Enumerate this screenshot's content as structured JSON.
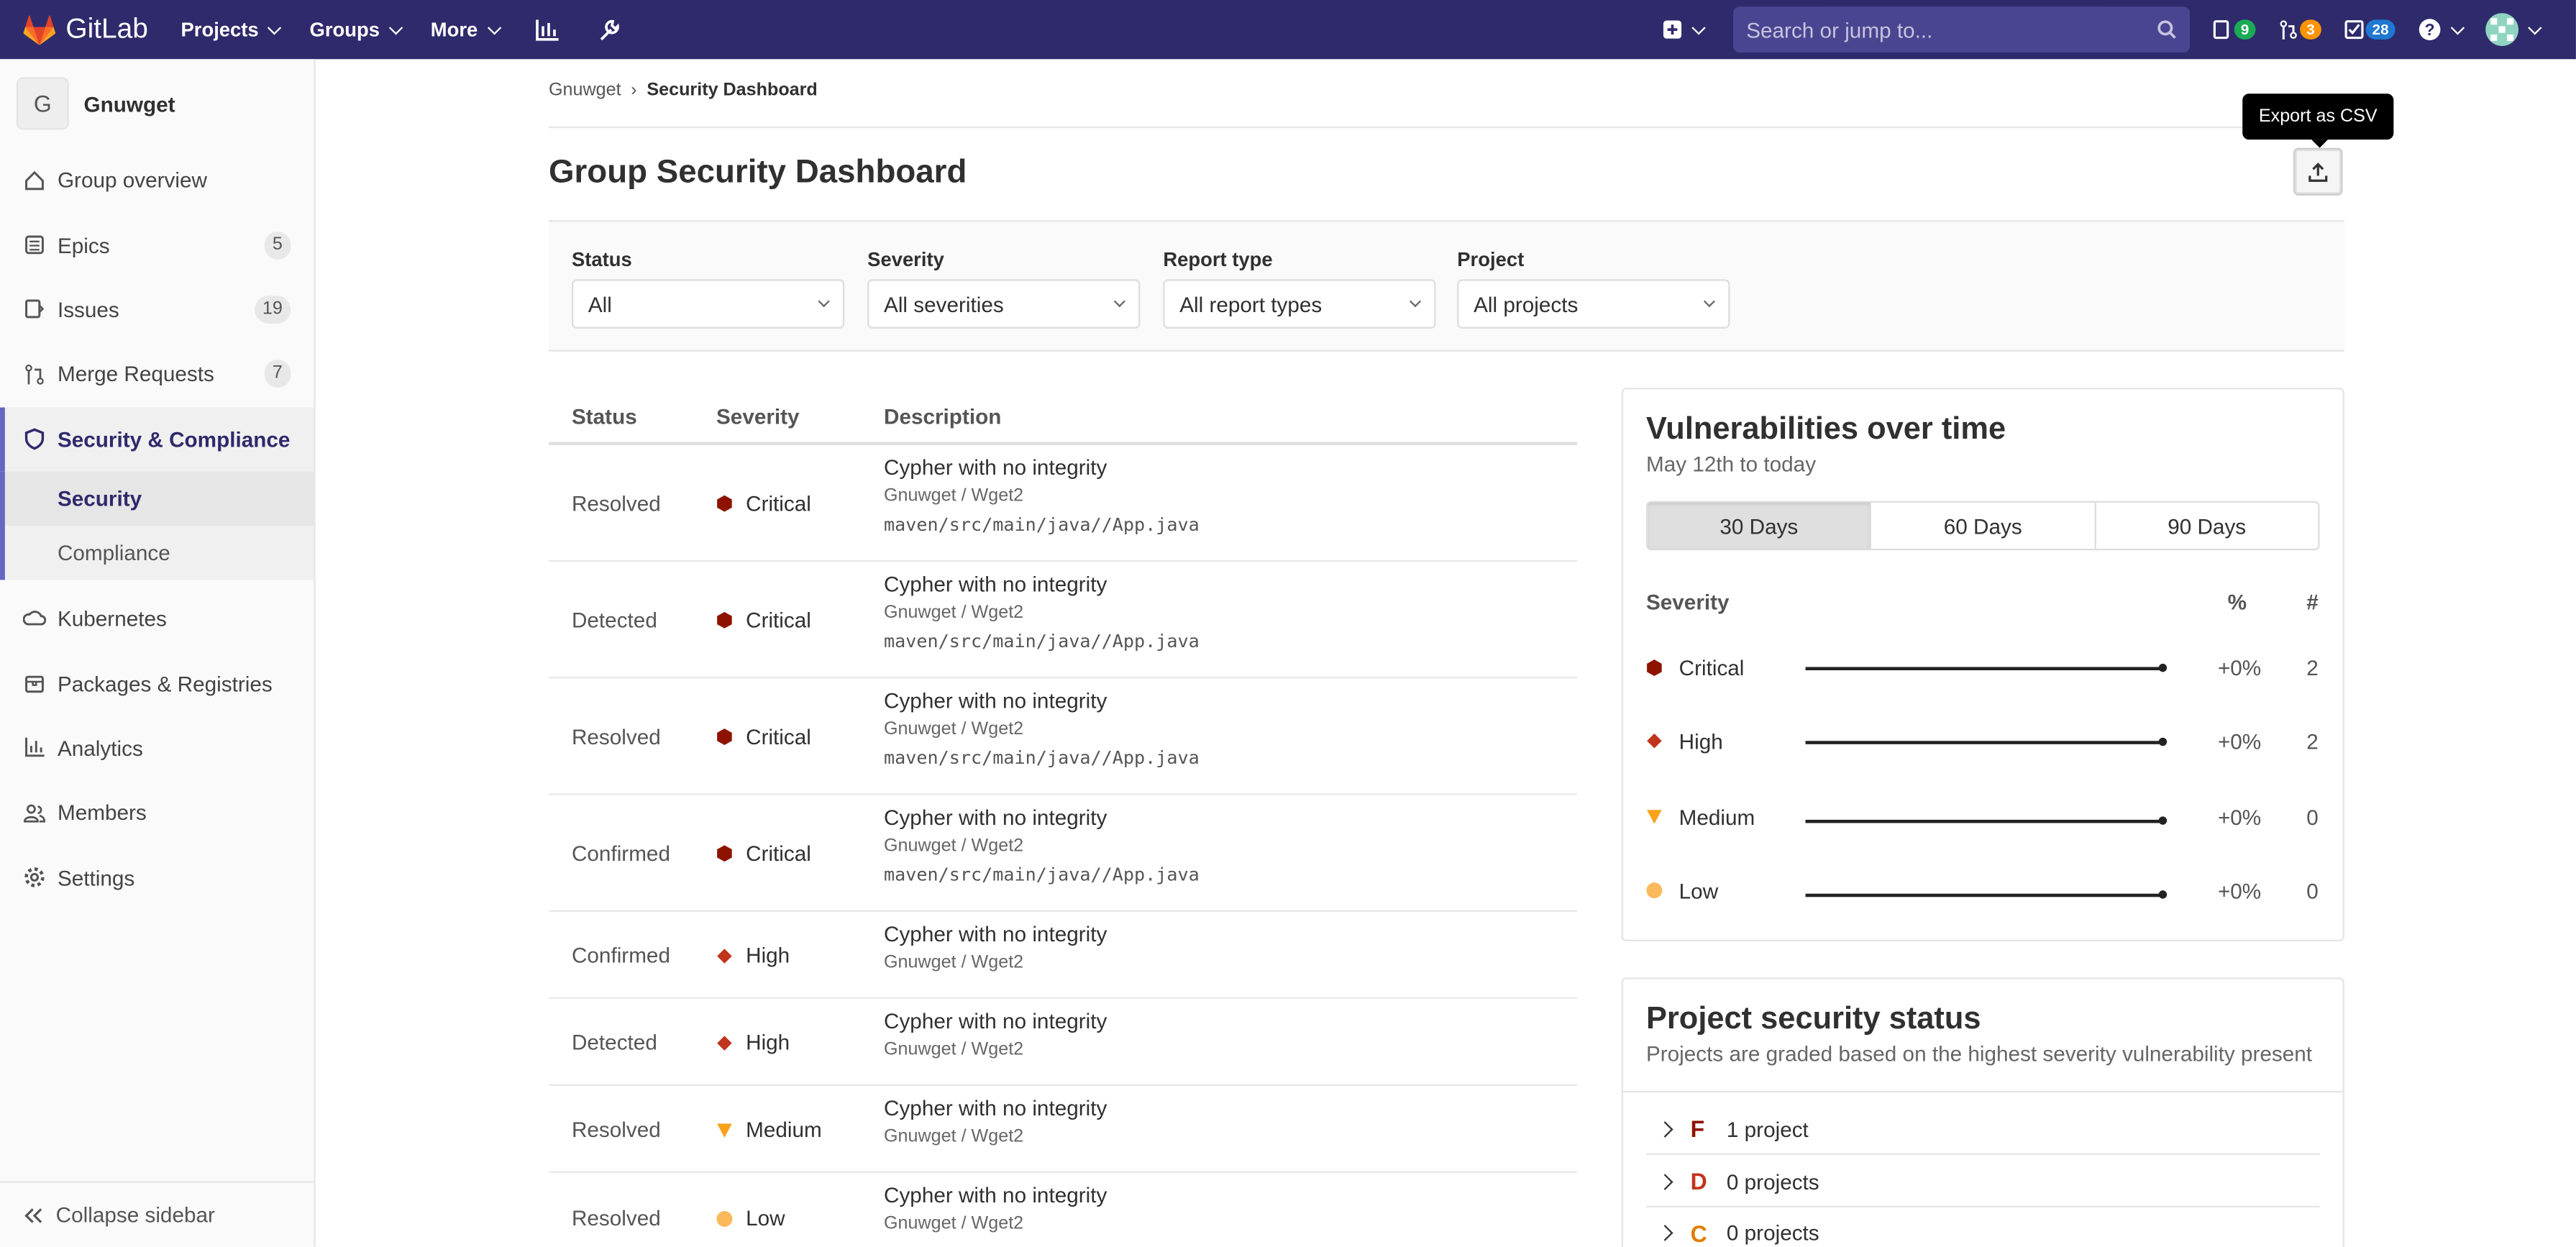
{
  "topbar": {
    "brand": "GitLab",
    "menu": [
      {
        "label": "Projects"
      },
      {
        "label": "Groups"
      },
      {
        "label": "More"
      }
    ],
    "search_placeholder": "Search or jump to...",
    "issues_count": "9",
    "mr_count": "3",
    "todo_count": "28",
    "colors": {
      "bg": "#2f2a6b",
      "issues": "#1aaa55",
      "mr": "#fc9403",
      "todo": "#1f78d1"
    }
  },
  "sidebar": {
    "group_initial": "G",
    "group_name": "Gnuwget",
    "items": [
      {
        "label": "Group overview",
        "icon": "home-icon"
      },
      {
        "label": "Epics",
        "icon": "epic-icon",
        "badge": "5"
      },
      {
        "label": "Issues",
        "icon": "issues-icon",
        "badge": "19"
      },
      {
        "label": "Merge Requests",
        "icon": "merge-request-icon",
        "badge": "7"
      },
      {
        "label": "Security & Compliance",
        "icon": "shield-icon"
      }
    ],
    "sub_items": [
      {
        "label": "Security"
      },
      {
        "label": "Compliance"
      }
    ],
    "items_after": [
      {
        "label": "Kubernetes",
        "icon": "kubernetes-icon"
      },
      {
        "label": "Packages & Registries",
        "icon": "package-icon"
      },
      {
        "label": "Analytics",
        "icon": "chart-icon"
      },
      {
        "label": "Members",
        "icon": "users-icon"
      },
      {
        "label": "Settings",
        "icon": "gear-icon"
      }
    ],
    "collapse_label": "Collapse sidebar"
  },
  "breadcrumb": {
    "parent": "Gnuwget",
    "current": "Security Dashboard"
  },
  "page_title": "Group Security Dashboard",
  "export_tooltip": "Export as CSV",
  "filters": [
    {
      "label": "Status",
      "value": "All"
    },
    {
      "label": "Severity",
      "value": "All severities"
    },
    {
      "label": "Report type",
      "value": "All report types"
    },
    {
      "label": "Project",
      "value": "All projects"
    }
  ],
  "table": {
    "headers": {
      "status": "Status",
      "severity": "Severity",
      "description": "Description"
    },
    "rows": [
      {
        "status": "Resolved",
        "severity": "Critical",
        "title": "Cypher with no integrity",
        "project": "Gnuwget / Wget2",
        "file": "maven/src/main/java//App.java"
      },
      {
        "status": "Detected",
        "severity": "Critical",
        "title": "Cypher with no integrity",
        "project": "Gnuwget / Wget2",
        "file": "maven/src/main/java//App.java"
      },
      {
        "status": "Resolved",
        "severity": "Critical",
        "title": "Cypher with no integrity",
        "project": "Gnuwget / Wget2",
        "file": "maven/src/main/java//App.java"
      },
      {
        "status": "Confirmed",
        "severity": "Critical",
        "title": "Cypher with no integrity",
        "project": "Gnuwget / Wget2",
        "file": "maven/src/main/java//App.java"
      },
      {
        "status": "Confirmed",
        "severity": "High",
        "title": "Cypher with no integrity",
        "project": "Gnuwget / Wget2"
      },
      {
        "status": "Detected",
        "severity": "High",
        "title": "Cypher with no integrity",
        "project": "Gnuwget / Wget2"
      },
      {
        "status": "Resolved",
        "severity": "Medium",
        "title": "Cypher with no integrity",
        "project": "Gnuwget / Wget2"
      },
      {
        "status": "Resolved",
        "severity": "Low",
        "title": "Cypher with no integrity",
        "project": "Gnuwget / Wget2"
      }
    ]
  },
  "vulns_over_time": {
    "title": "Vulnerabilities over time",
    "subtitle": "May 12th to today",
    "ranges": [
      {
        "label": "30 Days",
        "selected": true
      },
      {
        "label": "60 Days"
      },
      {
        "label": "90 Days"
      }
    ],
    "headers": {
      "severity": "Severity",
      "percent": "%",
      "count": "#"
    },
    "rows": [
      {
        "name": "Critical",
        "percent": "+0%",
        "count": "2"
      },
      {
        "name": "High",
        "percent": "+0%",
        "count": "2"
      },
      {
        "name": "Medium",
        "percent": "+0%",
        "count": "0"
      },
      {
        "name": "Low",
        "percent": "+0%",
        "count": "0"
      }
    ]
  },
  "project_status": {
    "title": "Project security status",
    "subtitle": "Projects are graded based on the highest severity vulnerability present",
    "grades": [
      {
        "letter": "F",
        "count": "1 project",
        "color": "#8d1300"
      },
      {
        "letter": "D",
        "count": "0 projects",
        "color": "#c0341d"
      },
      {
        "letter": "C",
        "count": "0 projects",
        "color": "#de7e00"
      }
    ]
  },
  "severity_colors": {
    "Critical": "#8d1300",
    "High": "#c0341d",
    "Medium": "#f8a21b",
    "Low": "#fcb95c"
  }
}
